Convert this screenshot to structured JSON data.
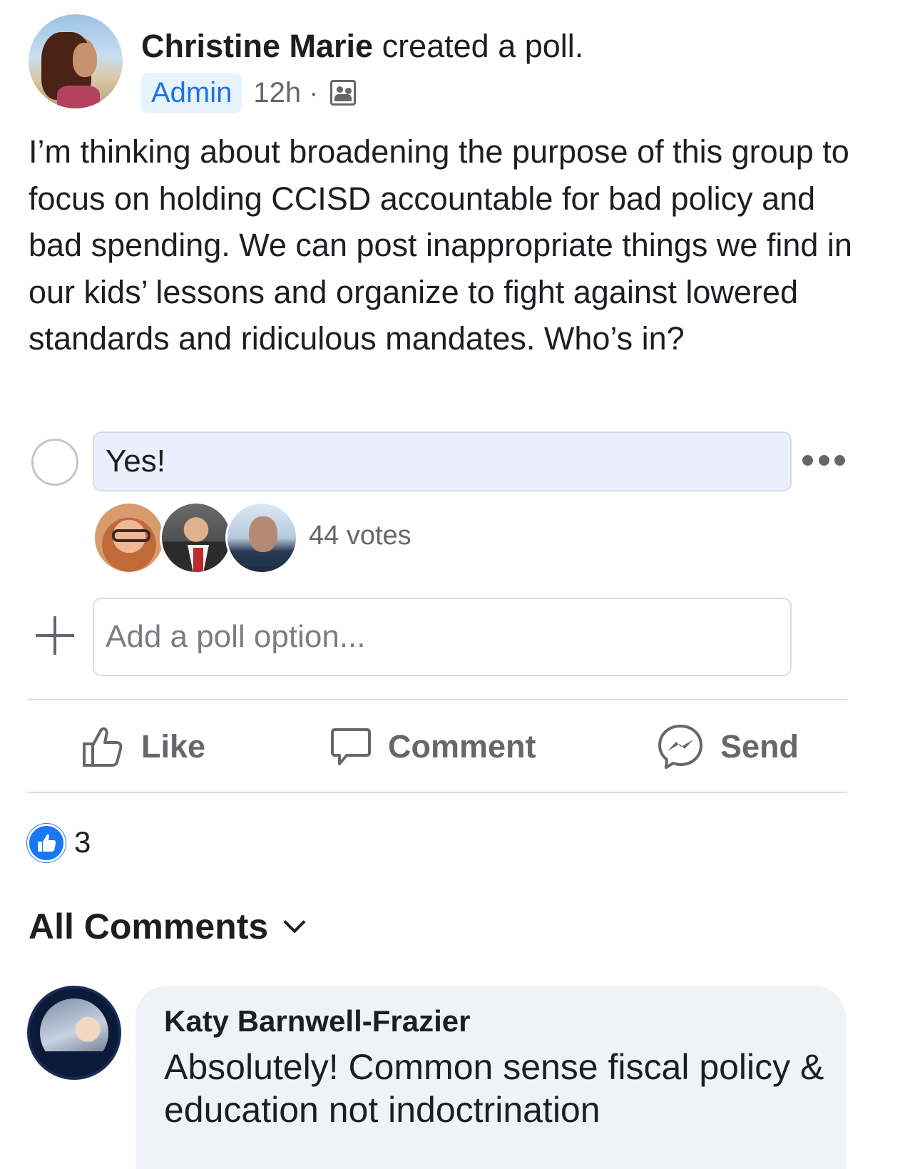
{
  "post": {
    "author": "Christine Marie",
    "action": " created a poll.",
    "badge": "Admin",
    "time": "12h ·",
    "text": "I’m thinking about broadening the purpose of this group to focus on holding CCISD accountable for bad policy and bad spending. We can post inappropriate things we find in our kids’ lessons and organize to fight against lowered standards and ridiculous mandates. Who’s in?"
  },
  "poll": {
    "option_label": "Yes!",
    "votes_label": "44 votes",
    "add_placeholder": "Add a poll option..."
  },
  "actions": {
    "like": "Like",
    "comment": "Comment",
    "send": "Send"
  },
  "reactions": {
    "count": "3"
  },
  "comments": {
    "header": "All Comments",
    "items": [
      {
        "author": "Katy Barnwell-Frazier",
        "text": "Absolutely! Common sense fiscal policy & education not indoctrination"
      }
    ]
  },
  "colors": {
    "accent": "#1877f2",
    "admin_badge_bg": "#e7f3ff",
    "muted_text": "#65676b"
  }
}
